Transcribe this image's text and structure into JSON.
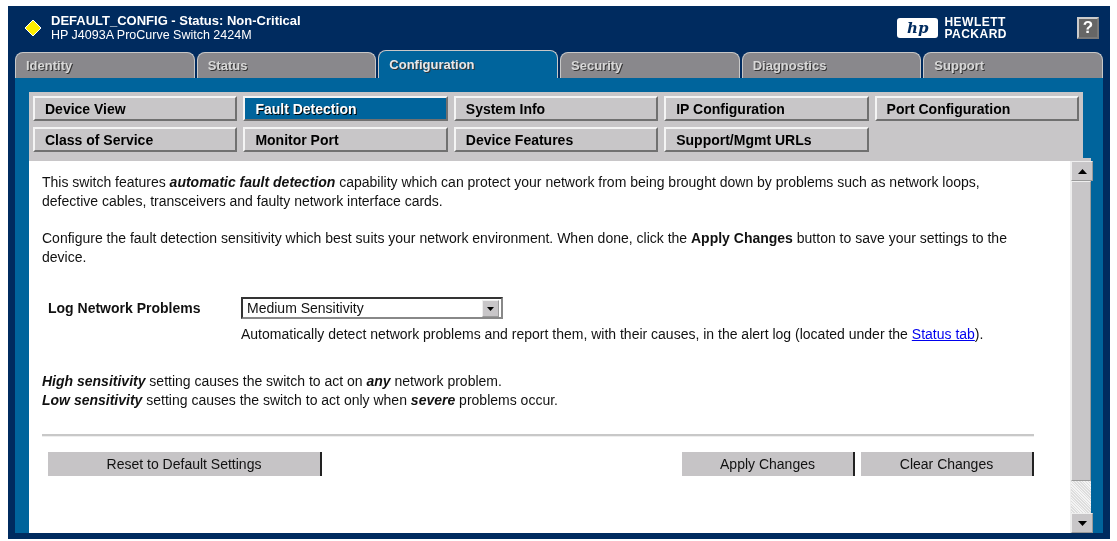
{
  "window": {
    "title": "DEFAULT_CONFIG - Status: Non-Critical",
    "subtitle": "HP J4093A ProCurve Switch 2424M"
  },
  "logo": {
    "mark": "hp",
    "lines": [
      "HEWLETT",
      "PACKARD"
    ]
  },
  "help_button": "?",
  "tabs": [
    {
      "label": "Identity",
      "selected": false
    },
    {
      "label": "Status",
      "selected": false
    },
    {
      "label": "Configuration",
      "selected": true
    },
    {
      "label": "Security",
      "selected": false
    },
    {
      "label": "Diagnostics",
      "selected": false
    },
    {
      "label": "Support",
      "selected": false
    }
  ],
  "subnav": [
    {
      "label": "Device View",
      "selected": false
    },
    {
      "label": "Fault Detection",
      "selected": true
    },
    {
      "label": "System Info",
      "selected": false
    },
    {
      "label": "IP Configuration",
      "selected": false
    },
    {
      "label": "Port Configuration",
      "selected": false
    },
    {
      "label": "Class of Service",
      "selected": false
    },
    {
      "label": "Monitor Port",
      "selected": false
    },
    {
      "label": "Device Features",
      "selected": false
    },
    {
      "label": "Support/Mgmt URLs",
      "selected": false
    }
  ],
  "intro": [
    "This switch features *automatic fault detection* capability which can protect your network from being brought down by problems such as network loops, defective cables, transceivers and faulty network interface cards.",
    "Configure the fault detection sensitivity which best suits your network environment. When done, click the **Apply Changes** button to save your settings to the device."
  ],
  "setting": {
    "label": "Log Network Problems",
    "value": "Medium Sensitivity",
    "hint_before": "Automatically detect network problems and report them, with their causes, in the alert log (located under the ",
    "hint_link": "Status tab",
    "hint_after": ")."
  },
  "notes": [
    "*High sensitivity* setting causes the switch to act on *any* network problem.",
    "*Low sensitivity* setting causes the switch to act only when *severe* problems occur."
  ],
  "buttons": {
    "left": [
      "Reset to Default Settings"
    ],
    "right": [
      "Apply Changes",
      "Clear Changes"
    ]
  }
}
